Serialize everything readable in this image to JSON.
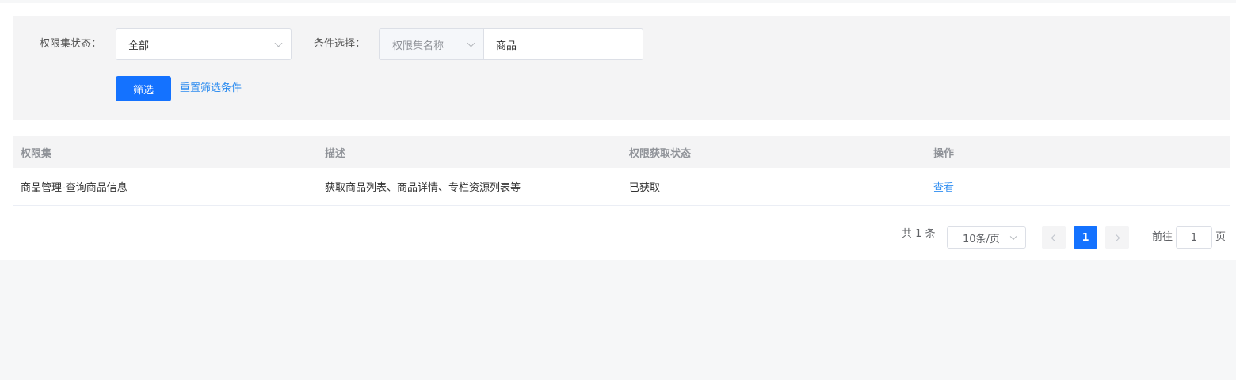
{
  "filters": {
    "status_label": "权限集状态：",
    "status_value": "全部",
    "condition_label": "条件选择：",
    "condition_type": "权限集名称",
    "condition_value": "商品",
    "filter_button": "筛选",
    "reset_link": "重置筛选条件"
  },
  "table": {
    "columns": [
      "权限集",
      "描述",
      "权限获取状态",
      "操作"
    ],
    "rows": [
      {
        "name": "商品管理-查询商品信息",
        "description": "获取商品列表、商品详情、专栏资源列表等",
        "status": "已获取",
        "action": "查看"
      }
    ]
  },
  "pagination": {
    "total_text": "共 1 条",
    "page_size": "10条/页",
    "current_page": "1",
    "goto_prefix": "前往",
    "goto_value": "1",
    "goto_suffix": "页"
  },
  "colors": {
    "primary": "#1472ff",
    "link": "#2d8cf0"
  }
}
